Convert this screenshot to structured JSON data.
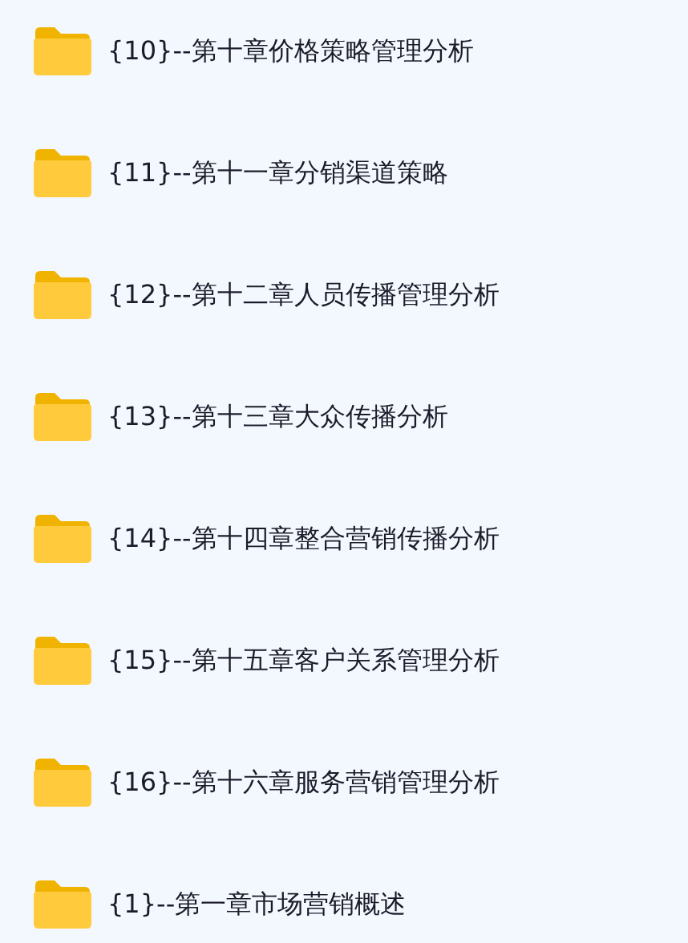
{
  "folders": [
    {
      "name": "{10}--第十章价格策略管理分析"
    },
    {
      "name": "{11}--第十一章分销渠道策略"
    },
    {
      "name": "{12}--第十二章人员传播管理分析"
    },
    {
      "name": "{13}--第十三章大众传播分析"
    },
    {
      "name": "{14}--第十四章整合营销传播分析"
    },
    {
      "name": "{15}--第十五章客户关系管理分析"
    },
    {
      "name": "{16}--第十六章服务营销管理分析"
    },
    {
      "name": "{1}--第一章市场营销概述"
    }
  ]
}
